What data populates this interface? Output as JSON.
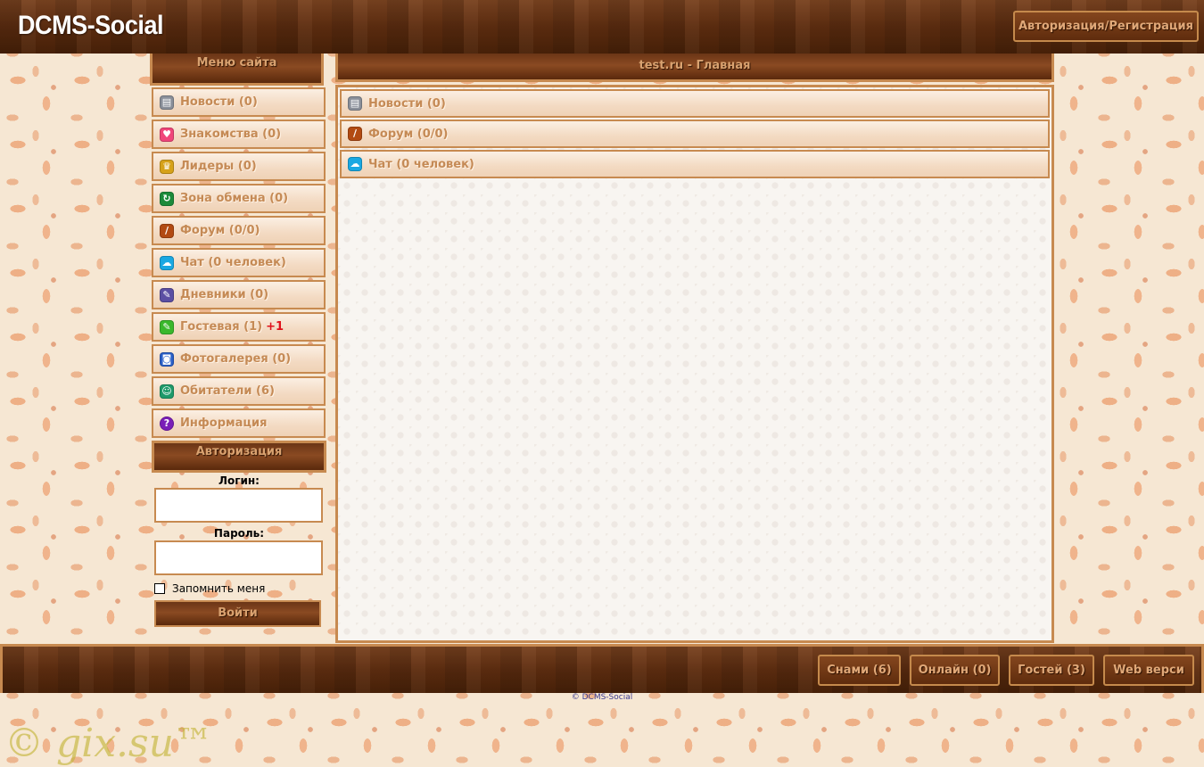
{
  "header": {
    "logo": "DCMS-Social",
    "auth_button": "Авторизация/Регистрация"
  },
  "menu": {
    "title": "Меню сайта",
    "items": [
      {
        "label": "Новости (0)",
        "icon": "newspaper-icon",
        "color": "#8a8f99",
        "glyph": "▤"
      },
      {
        "label": "Знакомства (0)",
        "icon": "heart-icon",
        "color": "#f0457a",
        "glyph": "♥"
      },
      {
        "label": "Лидеры (0)",
        "icon": "trophy-icon",
        "color": "#d6a21a",
        "glyph": "♛"
      },
      {
        "label": "Зона обмена (0)",
        "icon": "exchange-icon",
        "color": "#1c8a3a",
        "glyph": "↻"
      },
      {
        "label": "Форум (0/0)",
        "icon": "forum-pen-icon",
        "color": "#b24a12",
        "glyph": "/"
      },
      {
        "label": "Чат (0 человек)",
        "icon": "chat-icon",
        "color": "#1aa8e2",
        "glyph": "☁"
      },
      {
        "label": "Дневники (0)",
        "icon": "diary-icon",
        "color": "#5b4fa3",
        "glyph": "✎"
      },
      {
        "label": "Гостевая (1)",
        "badge": "+1",
        "icon": "guestbook-icon",
        "color": "#3ab82c",
        "glyph": "✎"
      },
      {
        "label": "Фотогалерея (0)",
        "icon": "camera-icon",
        "color": "#2a5fc7",
        "glyph": "◙"
      },
      {
        "label": "Обитатели (6)",
        "icon": "users-icon",
        "color": "#1e9a6a",
        "glyph": "☺"
      },
      {
        "label": "Информация",
        "icon": "question-icon",
        "color": "#7a1fb8",
        "glyph": "?"
      }
    ]
  },
  "auth": {
    "title": "Авторизация",
    "login_label": "Логин:",
    "password_label": "Пароль:",
    "remember_label": "Запомнить меня",
    "submit": "Войти"
  },
  "main": {
    "title": "test.ru - Главная",
    "items": [
      {
        "label": "Новости (0)",
        "icon": "newspaper-icon",
        "color": "#8a8f99",
        "glyph": "▤"
      },
      {
        "label": "Форум (0/0)",
        "icon": "forum-pen-icon",
        "color": "#b24a12",
        "glyph": "/"
      },
      {
        "label": "Чат (0 человек)",
        "icon": "chat-icon",
        "color": "#1aa8e2",
        "glyph": "☁"
      }
    ]
  },
  "footer": {
    "buttons": [
      "Снами (6)",
      "Онлайн (0)",
      "Гостей (3)",
      "Web верси"
    ],
    "copyright": "© DCMS-Social",
    "watermark": "© gix.su™"
  }
}
